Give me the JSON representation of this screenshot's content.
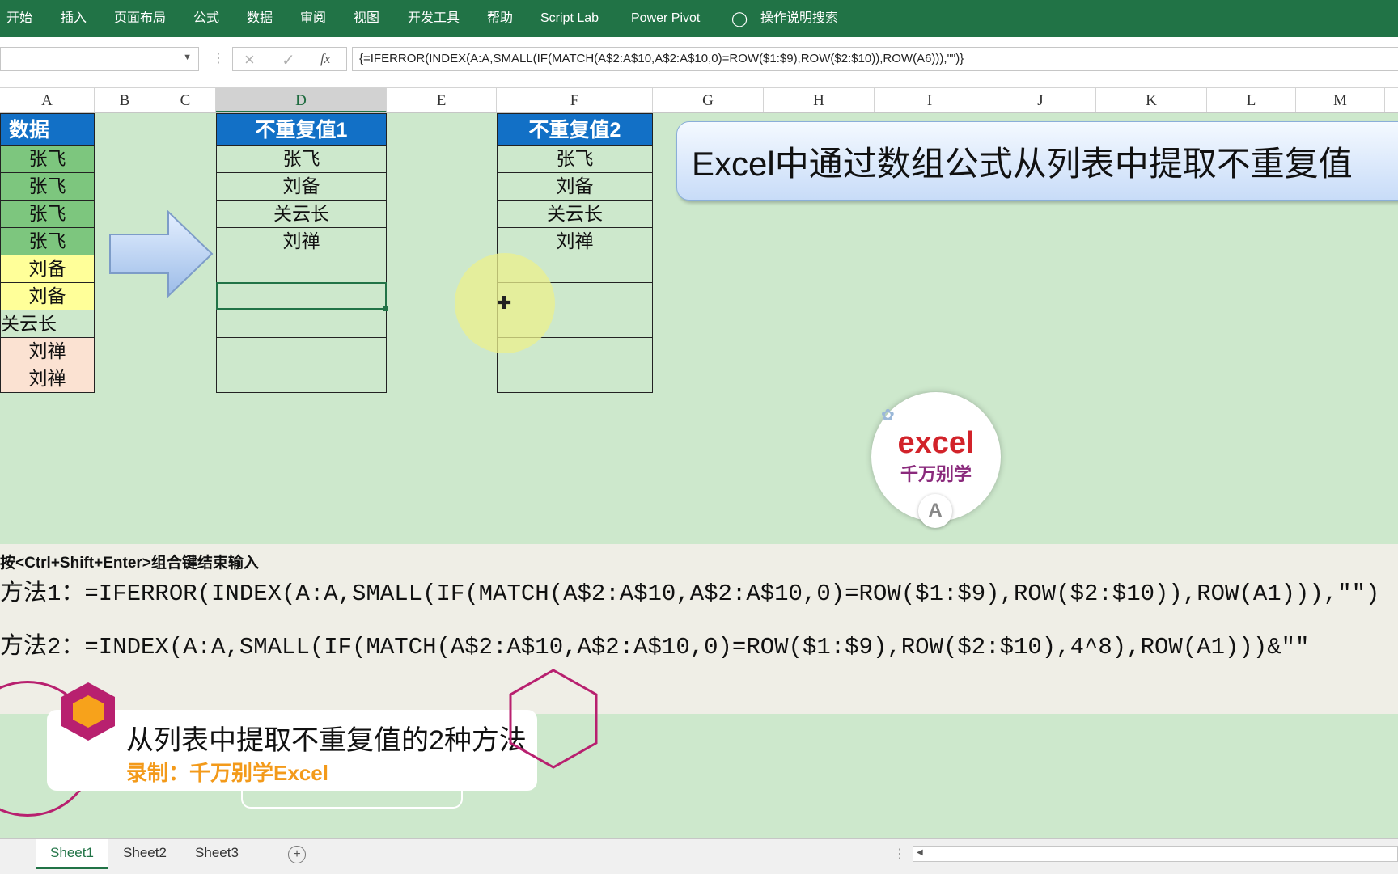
{
  "ribbon": {
    "items": [
      "开始",
      "插入",
      "页面布局",
      "公式",
      "数据",
      "审阅",
      "视图",
      "开发工具",
      "帮助",
      "Script Lab",
      "Power Pivot"
    ],
    "tell_me": "操作说明搜索"
  },
  "formula_bar": {
    "name_box": "",
    "formula": "{=IFERROR(INDEX(A:A,SMALL(IF(MATCH(A$2:A$10,A$2:A$10,0)=ROW($1:$9),ROW($2:$10)),ROW(A6))),\"\")}",
    "fx_label": "fx"
  },
  "columns": [
    "A",
    "B",
    "C",
    "D",
    "E",
    "F",
    "G",
    "H",
    "I",
    "J",
    "K",
    "L",
    "M"
  ],
  "selected_column": "D",
  "source": {
    "header": "数据",
    "values": [
      "张飞",
      "张飞",
      "张飞",
      "张飞",
      "刘备",
      "刘备",
      "关云长",
      "刘禅",
      "刘禅"
    ],
    "colors": [
      "#7dc67e",
      "#7dc67e",
      "#7dc67e",
      "#7dc67e",
      "#ffff99",
      "#ffff99",
      "#cde8cc",
      "#fbe2d2",
      "#fbe2d2"
    ]
  },
  "result1": {
    "header": "不重复值1",
    "values": [
      "张飞",
      "刘备",
      "关云长",
      "刘禅",
      "",
      "",
      "",
      "",
      ""
    ]
  },
  "result2": {
    "header": "不重复值2",
    "values": [
      "张飞",
      "刘备",
      "关云长",
      "刘禅",
      "",
      "",
      "",
      "",
      ""
    ]
  },
  "banner": {
    "title": "Excel中通过数组公式从列表中提取不重复值"
  },
  "logo": {
    "word": "excel",
    "subtitle": "千万别学",
    "badge": "A"
  },
  "notes": {
    "hint": "按<Ctrl+Shift+Enter>组合键结束输入",
    "method1": "方法1：=IFERROR(INDEX(A:A,SMALL(IF(MATCH(A$2:A$10,A$2:A$10,0)=ROW($1:$9),ROW($2:$10)),ROW(A1))),\"\")",
    "method2": "方法2：=INDEX(A:A,SMALL(IF(MATCH(A$2:A$10,A$2:A$10,0)=ROW($1:$9),ROW($2:$10),4^8),ROW(A1)))&\"\""
  },
  "subtitle": {
    "title": "从列表中提取不重复值的2种方法",
    "author": "录制：千万别学Excel"
  },
  "sheets": {
    "tabs": [
      "Sheet1",
      "Sheet2",
      "Sheet3"
    ],
    "active": "Sheet1",
    "add_symbol": "+"
  },
  "colors": {
    "ribbon": "#217346",
    "sheet_bg": "#cde8cc",
    "header_blue": "#1270c6",
    "accent_orange": "#f39a1a",
    "hex_purple": "#b8206f"
  }
}
